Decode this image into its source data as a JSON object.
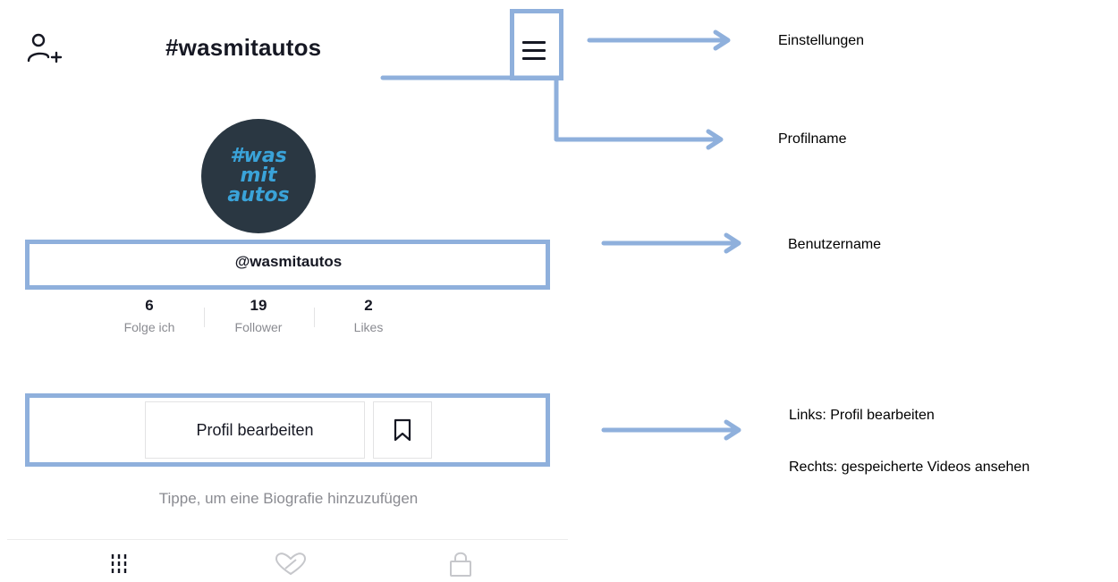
{
  "header": {
    "title": "#wasmitautos",
    "add_user_icon": "add-user-icon",
    "menu_icon": "hamburger-menu-icon"
  },
  "avatar": {
    "line1": "#was",
    "line2": "mit",
    "line3": "autos",
    "bg_color": "#2a3742",
    "text_color": "#3aa3d9"
  },
  "profile": {
    "username": "@wasmitautos",
    "stats": [
      {
        "value": "6",
        "label": "Folge ich"
      },
      {
        "value": "19",
        "label": "Follower"
      },
      {
        "value": "2",
        "label": "Likes"
      }
    ],
    "edit_label": "Profil bearbeiten",
    "bio_placeholder": "Tippe, um eine Biografie hinzuzufügen"
  },
  "tabs": {
    "icons": [
      "grid-icon",
      "liked-videos-icon",
      "lock-icon"
    ]
  },
  "annotations": {
    "settings": "Einstellungen",
    "profile_name": "Profilname",
    "username": "Benutzername",
    "left_edit": "Links: Profil bearbeiten",
    "right_saved": "Rechts: gespeicherte Videos ansehen",
    "frame_color": "#8fb0dc"
  }
}
